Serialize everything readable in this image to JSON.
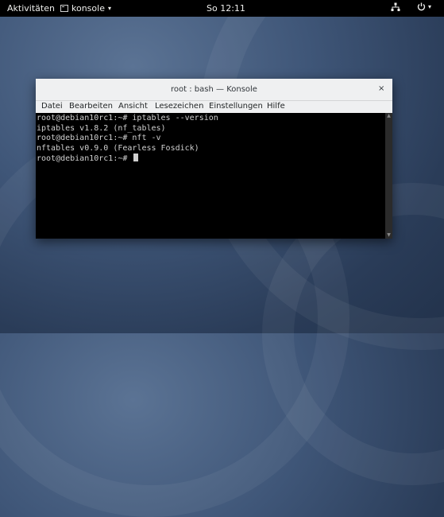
{
  "topbar": {
    "activities": "Aktivitäten",
    "app_name": "konsole",
    "clock": "So 12:11"
  },
  "window": {
    "title": "root : bash — Konsole",
    "close_glyph": "×",
    "menu": [
      "Datei",
      "Bearbeiten",
      "Ansicht",
      "Lesezeichen",
      "Einstellungen",
      "Hilfe"
    ],
    "terminal_lines": [
      "root@debian10rc1:~# iptables --version",
      "iptables v1.8.2 (nf_tables)",
      "root@debian10rc1:~# nft -v",
      "nftables v0.9.0 (Fearless Fosdick)",
      "root@debian10rc1:~# "
    ]
  },
  "icons": {
    "app": "terminal-icon",
    "network": "network-icon",
    "power": "power-icon",
    "dropdown": "caret-down-icon"
  }
}
